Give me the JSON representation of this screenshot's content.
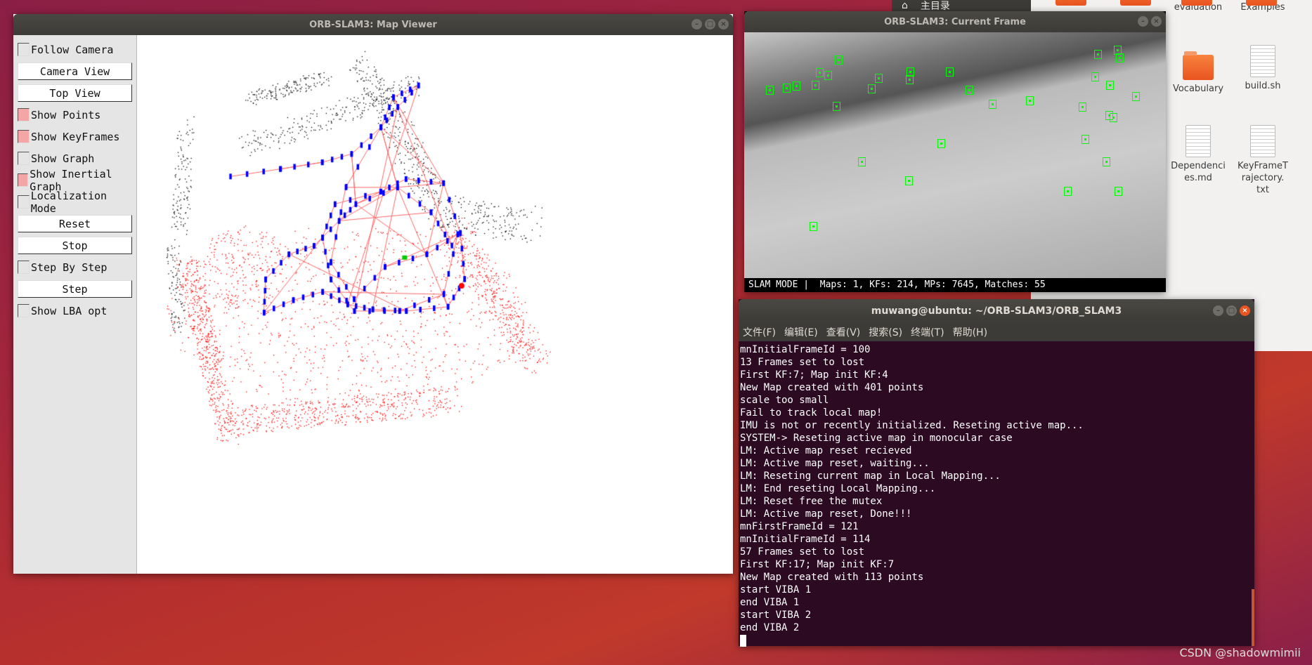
{
  "topbar": {
    "home_icon": "home-icon",
    "label": "主目录"
  },
  "file_manager": {
    "items": [
      {
        "label": "evaluation",
        "type": "folder"
      },
      {
        "label": "Examples",
        "type": "folder"
      },
      {
        "label": "Vocabulary",
        "type": "folder"
      },
      {
        "label": "build.sh",
        "type": "script"
      },
      {
        "label": "Dependenci\nes.md",
        "type": "text"
      },
      {
        "label": "KeyFrameT\nrajectory.\ntxt",
        "type": "text"
      }
    ]
  },
  "map_viewer": {
    "title": "ORB-SLAM3: Map Viewer",
    "controls": [
      {
        "type": "checkbox",
        "label": "Follow Camera",
        "checked": false
      },
      {
        "type": "button",
        "label": "Camera View"
      },
      {
        "type": "button",
        "label": "Top View"
      },
      {
        "type": "checkbox",
        "label": "Show Points",
        "checked": true
      },
      {
        "type": "checkbox",
        "label": "Show KeyFrames",
        "checked": true
      },
      {
        "type": "checkbox",
        "label": "Show Graph",
        "checked": false
      },
      {
        "type": "checkbox",
        "label": "Show Inertial Graph",
        "checked": true
      },
      {
        "type": "checkbox",
        "label": "Localization Mode",
        "checked": false
      },
      {
        "type": "button",
        "label": "Reset"
      },
      {
        "type": "button",
        "label": "Stop"
      },
      {
        "type": "checkbox",
        "label": "Step By Step",
        "checked": false
      },
      {
        "type": "button",
        "label": "Step"
      },
      {
        "type": "checkbox",
        "label": "Show LBA opt",
        "checked": false
      }
    ],
    "colors": {
      "map_points": "#000000",
      "local_points": "#ff0000",
      "keyframes": "#0000ff",
      "graph": "#ff6666",
      "current_camera": "#00cc00"
    }
  },
  "current_frame": {
    "title": "ORB-SLAM3: Current Frame",
    "status": "SLAM MODE |  Maps: 1, KFs: 214, MPs: 7645, Matches: 55",
    "feature_color": "#00ff00"
  },
  "terminal": {
    "title": "muwang@ubuntu: ~/ORB-SLAM3/ORB_SLAM3",
    "menu": [
      "文件(F)",
      "编辑(E)",
      "查看(V)",
      "搜索(S)",
      "终端(T)",
      "帮助(H)"
    ],
    "lines": [
      "mnInitialFrameId = 100",
      "13 Frames set to lost",
      "First KF:7; Map init KF:4",
      "New Map created with 401 points",
      "scale too small",
      "Fail to track local map!",
      "IMU is not or recently initialized. Reseting active map...",
      "SYSTEM-> Reseting active map in monocular case",
      "LM: Active map reset recieved",
      "LM: Active map reset, waiting...",
      "LM: Reseting current map in Local Mapping...",
      "LM: End reseting Local Mapping...",
      "LM: Reset free the mutex",
      "LM: Active map reset, Done!!!",
      "mnFirstFrameId = 121",
      "mnInitialFrameId = 114",
      "57 Frames set to lost",
      "First KF:17; Map init KF:7",
      "New Map created with 113 points",
      "start VIBA 1",
      "end VIBA 1",
      "start VIBA 2",
      "end VIBA 2"
    ]
  },
  "watermark": "CSDN @shadowmimii"
}
